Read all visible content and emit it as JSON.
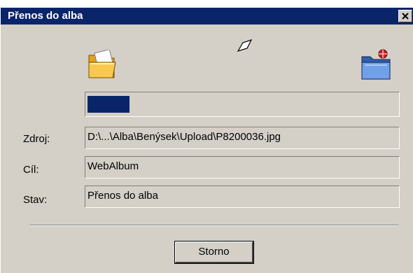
{
  "window": {
    "title": "Přenos do alba"
  },
  "icons": {
    "source": "folder-icon",
    "flying": "document-icon",
    "destination": "web-album-icon",
    "close": "close-icon"
  },
  "progress": {
    "fraction": 0.135
  },
  "fields": {
    "source_label": "Zdroj:",
    "source_value": "D:\\...\\Alba\\Benýsek\\Upload\\P8200036.jpg",
    "target_label": "Cíl:",
    "target_value": "WebAlbum",
    "status_label": "Stav:",
    "status_value": "Přenos do alba"
  },
  "buttons": {
    "cancel_label": "Storno"
  },
  "colors": {
    "titlebar": "#0a246a",
    "progress": "#0a246a",
    "dialog": "#d4d0c8"
  }
}
